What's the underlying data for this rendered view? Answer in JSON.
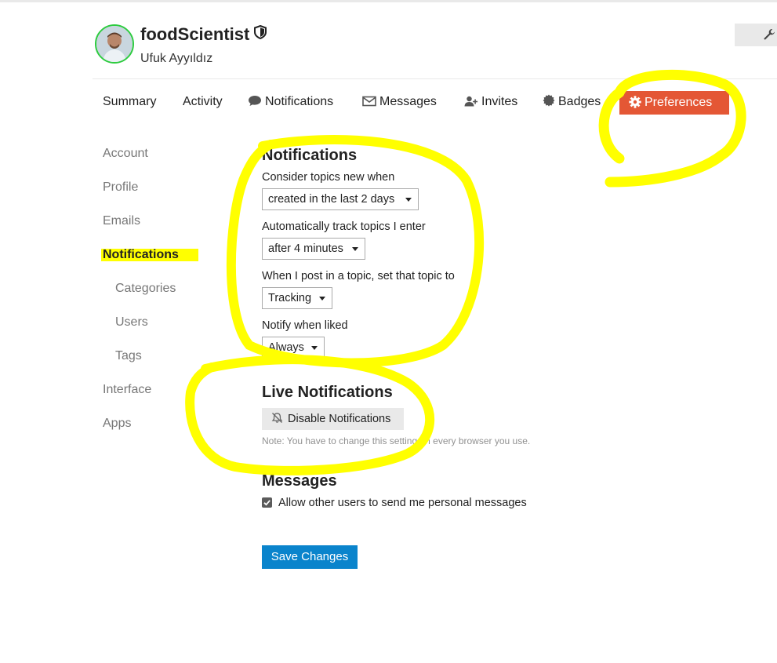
{
  "user": {
    "username": "foodScientist",
    "real_name": "Ufuk Ayyıldız"
  },
  "tabs": [
    {
      "label": "Summary"
    },
    {
      "label": "Activity"
    },
    {
      "label": "Notifications",
      "icon": "comment-icon"
    },
    {
      "label": "Messages",
      "icon": "envelope-icon"
    },
    {
      "label": "Invites",
      "icon": "user-plus-icon"
    },
    {
      "label": "Badges",
      "icon": "badge-icon"
    },
    {
      "label": "Preferences",
      "icon": "gear-icon",
      "active": true
    }
  ],
  "sidebar": [
    {
      "label": "Account"
    },
    {
      "label": "Profile"
    },
    {
      "label": "Emails"
    },
    {
      "label": "Notifications",
      "active": true
    },
    {
      "label": "Categories"
    },
    {
      "label": "Users"
    },
    {
      "label": "Tags"
    },
    {
      "label": "Interface"
    },
    {
      "label": "Apps"
    }
  ],
  "notifications": {
    "title": "Notifications",
    "settings": [
      {
        "label": "Consider topics new when",
        "value": "created in the last 2 days"
      },
      {
        "label": "Automatically track topics I enter",
        "value": "after 4 minutes"
      },
      {
        "label": "When I post in a topic, set that topic to",
        "value": "Tracking"
      },
      {
        "label": "Notify when liked",
        "value": "Always"
      }
    ]
  },
  "live_notifications": {
    "title": "Live Notifications",
    "button_label": "Disable Notifications",
    "note": "Note: You have to change this setting on every browser you use."
  },
  "messages": {
    "title": "Messages",
    "allow_pm_label": "Allow other users to send me personal messages",
    "allow_pm_checked": true
  },
  "save_label": "Save Changes",
  "colors": {
    "accent": "#e45735",
    "primary_button": "#0a84cc",
    "highlight_annotation": "#ffff00",
    "avatar_ring": "#2ecc40"
  }
}
